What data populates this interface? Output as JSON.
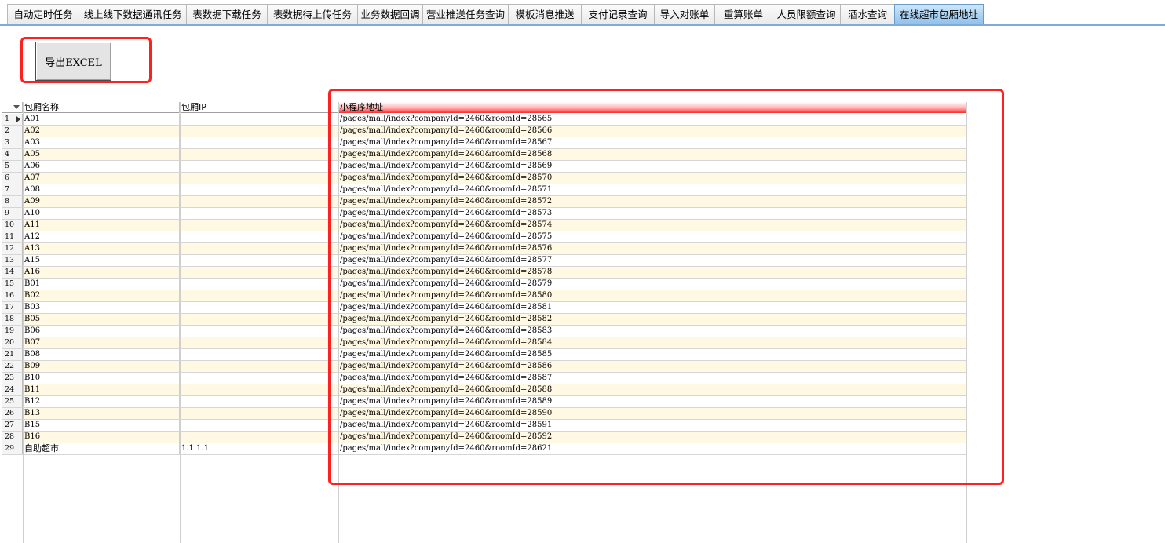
{
  "tabs": [
    {
      "label": "自动定时任务",
      "active": false
    },
    {
      "label": "线上线下数据通讯任务",
      "active": false
    },
    {
      "label": "表数据下载任务",
      "active": false
    },
    {
      "label": "表数据待上传任务",
      "active": false
    },
    {
      "label": "业务数据回调",
      "active": false
    },
    {
      "label": "营业推送任务查询",
      "active": false
    },
    {
      "label": "模板消息推送",
      "active": false
    },
    {
      "label": "支付记录查询",
      "active": false
    },
    {
      "label": "导入对账单",
      "active": false
    },
    {
      "label": "重算账单",
      "active": false
    },
    {
      "label": "人员限额查询",
      "active": false
    },
    {
      "label": "酒水查询",
      "active": false
    },
    {
      "label": "在线超市包厢地址",
      "active": true
    }
  ],
  "toolbar": {
    "export_label": "导出EXCEL"
  },
  "grid": {
    "columns": [
      "包厢名称",
      "包厢IP",
      "小程序地址"
    ],
    "rows": [
      {
        "idx": "1",
        "name": "A01",
        "ip": "",
        "url": "/pages/mall/index?companyId=2460&roomId=28565"
      },
      {
        "idx": "2",
        "name": "A02",
        "ip": "",
        "url": "/pages/mall/index?companyId=2460&roomId=28566"
      },
      {
        "idx": "3",
        "name": "A03",
        "ip": "",
        "url": "/pages/mall/index?companyId=2460&roomId=28567"
      },
      {
        "idx": "4",
        "name": "A05",
        "ip": "",
        "url": "/pages/mall/index?companyId=2460&roomId=28568"
      },
      {
        "idx": "5",
        "name": "A06",
        "ip": "",
        "url": "/pages/mall/index?companyId=2460&roomId=28569"
      },
      {
        "idx": "6",
        "name": "A07",
        "ip": "",
        "url": "/pages/mall/index?companyId=2460&roomId=28570"
      },
      {
        "idx": "7",
        "name": "A08",
        "ip": "",
        "url": "/pages/mall/index?companyId=2460&roomId=28571"
      },
      {
        "idx": "8",
        "name": "A09",
        "ip": "",
        "url": "/pages/mall/index?companyId=2460&roomId=28572"
      },
      {
        "idx": "9",
        "name": "A10",
        "ip": "",
        "url": "/pages/mall/index?companyId=2460&roomId=28573"
      },
      {
        "idx": "10",
        "name": "A11",
        "ip": "",
        "url": "/pages/mall/index?companyId=2460&roomId=28574"
      },
      {
        "idx": "11",
        "name": "A12",
        "ip": "",
        "url": "/pages/mall/index?companyId=2460&roomId=28575"
      },
      {
        "idx": "12",
        "name": "A13",
        "ip": "",
        "url": "/pages/mall/index?companyId=2460&roomId=28576"
      },
      {
        "idx": "13",
        "name": "A15",
        "ip": "",
        "url": "/pages/mall/index?companyId=2460&roomId=28577"
      },
      {
        "idx": "14",
        "name": "A16",
        "ip": "",
        "url": "/pages/mall/index?companyId=2460&roomId=28578"
      },
      {
        "idx": "15",
        "name": "B01",
        "ip": "",
        "url": "/pages/mall/index?companyId=2460&roomId=28579"
      },
      {
        "idx": "16",
        "name": "B02",
        "ip": "",
        "url": "/pages/mall/index?companyId=2460&roomId=28580"
      },
      {
        "idx": "17",
        "name": "B03",
        "ip": "",
        "url": "/pages/mall/index?companyId=2460&roomId=28581"
      },
      {
        "idx": "18",
        "name": "B05",
        "ip": "",
        "url": "/pages/mall/index?companyId=2460&roomId=28582"
      },
      {
        "idx": "19",
        "name": "B06",
        "ip": "",
        "url": "/pages/mall/index?companyId=2460&roomId=28583"
      },
      {
        "idx": "20",
        "name": "B07",
        "ip": "",
        "url": "/pages/mall/index?companyId=2460&roomId=28584"
      },
      {
        "idx": "21",
        "name": "B08",
        "ip": "",
        "url": "/pages/mall/index?companyId=2460&roomId=28585"
      },
      {
        "idx": "22",
        "name": "B09",
        "ip": "",
        "url": "/pages/mall/index?companyId=2460&roomId=28586"
      },
      {
        "idx": "23",
        "name": "B10",
        "ip": "",
        "url": "/pages/mall/index?companyId=2460&roomId=28587"
      },
      {
        "idx": "24",
        "name": "B11",
        "ip": "",
        "url": "/pages/mall/index?companyId=2460&roomId=28588"
      },
      {
        "idx": "25",
        "name": "B12",
        "ip": "",
        "url": "/pages/mall/index?companyId=2460&roomId=28589"
      },
      {
        "idx": "26",
        "name": "B13",
        "ip": "",
        "url": "/pages/mall/index?companyId=2460&roomId=28590"
      },
      {
        "idx": "27",
        "name": "B15",
        "ip": "",
        "url": "/pages/mall/index?companyId=2460&roomId=28591"
      },
      {
        "idx": "28",
        "name": "B16",
        "ip": "",
        "url": "/pages/mall/index?companyId=2460&roomId=28592"
      },
      {
        "idx": "29",
        "name": "自助超市",
        "ip": "1.1.1.1",
        "url": "/pages/mall/index?companyId=2460&roomId=28621"
      }
    ]
  },
  "colors": {
    "annotation": "#ff2020",
    "active_tab": "#8cc0ea",
    "alt_row": "#fff8e2"
  }
}
